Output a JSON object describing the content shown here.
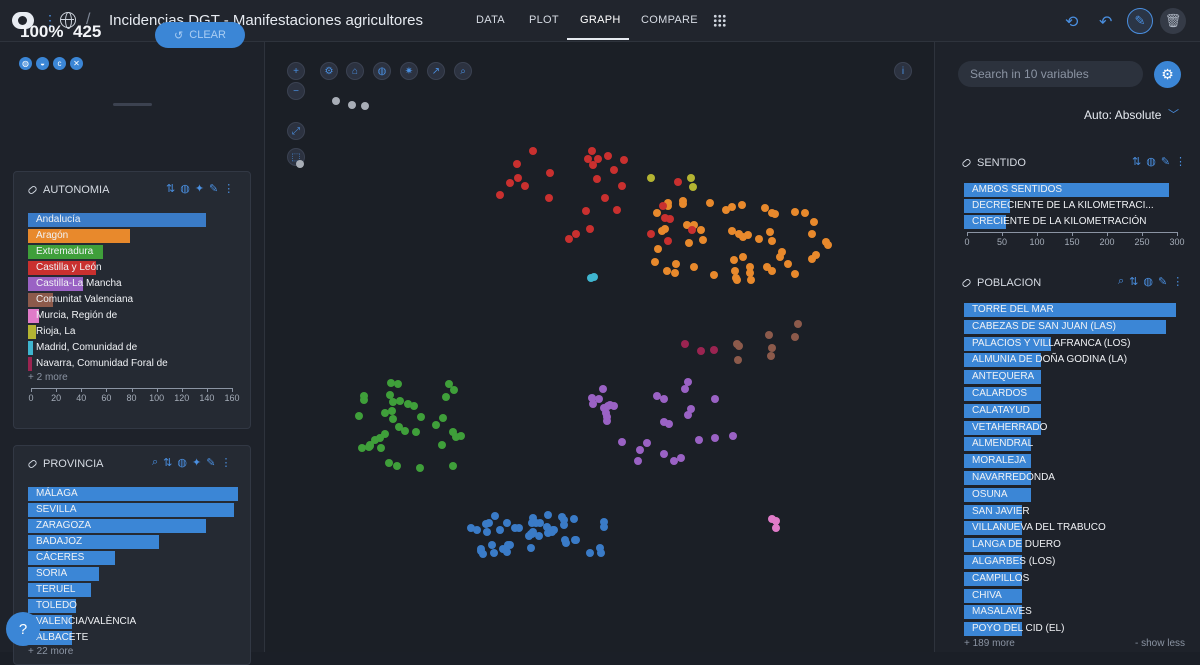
{
  "app": {
    "title": "Incidencias DGT - Manifestaciones agricultores",
    "tabs": [
      "DATA",
      "PLOT",
      "GRAPH",
      "COMPARE"
    ],
    "active_tab": "GRAPH"
  },
  "selection": {
    "percent": "100%",
    "count": "425",
    "clear_label": "CLEAR",
    "filter_icons": [
      "droplet-icon",
      "palette-icon",
      "c-icon",
      "pin-icon"
    ]
  },
  "cards": {
    "autonomia": {
      "title": "AUTONOMIA",
      "items": [
        {
          "label": "Andalucía",
          "value": 142,
          "color": "#3a7bc7"
        },
        {
          "label": "Aragón",
          "value": 81,
          "color": "#e8892c"
        },
        {
          "label": "Extremadura",
          "value": 60,
          "color": "#3f9f3a"
        },
        {
          "label": "Castilla y León",
          "value": 54,
          "color": "#c9302f"
        },
        {
          "label": "Castilla-La Mancha",
          "value": 44,
          "color": "#9a62c4"
        },
        {
          "label": "Comunitat Valenciana",
          "value": 20,
          "color": "#8c5a4b"
        },
        {
          "label": "Murcia, Región de",
          "value": 9,
          "color": "#e07bc8"
        },
        {
          "label": "Rioja, La",
          "value": 6,
          "color": "#b4b432"
        },
        {
          "label": "Madrid, Comunidad de",
          "value": 4,
          "color": "#3fb5cf"
        },
        {
          "label": "Navarra, Comunidad Foral de",
          "value": 3,
          "color": "#9b2451"
        }
      ],
      "more": "+ 2 more",
      "ticks": [
        "0",
        "20",
        "40",
        "60",
        "80",
        "100",
        "120",
        "140",
        "160"
      ]
    },
    "provincia": {
      "title": "PROVINCIA",
      "items": [
        {
          "label": "MÁLAGA",
          "value": 53
        },
        {
          "label": "SEVILLA",
          "value": 52
        },
        {
          "label": "ZARAGOZA",
          "value": 45
        },
        {
          "label": "BADAJOZ",
          "value": 33
        },
        {
          "label": "CÁCERES",
          "value": 22
        },
        {
          "label": "SORIA",
          "value": 18
        },
        {
          "label": "TERUEL",
          "value": 16
        },
        {
          "label": "TOLEDO",
          "value": 12
        },
        {
          "label": "VALENCIA/VALÈNCIA",
          "value": 11
        },
        {
          "label": "ALBACETE",
          "value": 11
        }
      ],
      "more": "+ 22 more"
    },
    "sentido": {
      "title": "SENTIDO",
      "items": [
        {
          "label": "AMBOS SENTIDOS",
          "value": 290
        },
        {
          "label": "DECRECIENTE DE LA KILOMETRACI...",
          "value": 65
        },
        {
          "label": "CRECIENTE DE LA KILOMETRACIÓN",
          "value": 60
        }
      ],
      "ticks": [
        "0",
        "50",
        "100",
        "150",
        "200",
        "250",
        "300"
      ]
    },
    "poblacion": {
      "title": "POBLACION",
      "items": [
        {
          "label": "TORRE DEL MAR",
          "value": 22
        },
        {
          "label": "CABEZAS DE SAN JUAN (LAS)",
          "value": 21
        },
        {
          "label": "PALACIOS Y VILLAFRANCA (LOS)",
          "value": 9
        },
        {
          "label": "ALMUNIA DE DOÑA GODINA (LA)",
          "value": 8
        },
        {
          "label": "ANTEQUERA",
          "value": 8
        },
        {
          "label": "CALARDOS",
          "value": 8
        },
        {
          "label": "CALATAYUD",
          "value": 8
        },
        {
          "label": "VETAHERRADO",
          "value": 8
        },
        {
          "label": "ALMENDRAL",
          "value": 7
        },
        {
          "label": "MORALEJA",
          "value": 7
        },
        {
          "label": "NAVARREDONDA",
          "value": 7
        },
        {
          "label": "OSUNA",
          "value": 7
        },
        {
          "label": "SAN JAVIER",
          "value": 6
        },
        {
          "label": "VILLANUEVA DEL TRABUCO",
          "value": 6
        },
        {
          "label": "LANGA DE DUERO",
          "value": 6
        },
        {
          "label": "ALGARBES (LOS)",
          "value": 6
        },
        {
          "label": "CAMPILLOS",
          "value": 6
        },
        {
          "label": "CHIVA",
          "value": 6
        },
        {
          "label": "MASALAVES",
          "value": 6
        },
        {
          "label": "POYO DEL CID (EL)",
          "value": 6
        }
      ],
      "more": "+ 189 more",
      "show_less": "- show less"
    }
  },
  "right": {
    "search_placeholder": "Search in 10 variables",
    "scale_mode": "Auto: Absolute"
  },
  "help": "?"
}
